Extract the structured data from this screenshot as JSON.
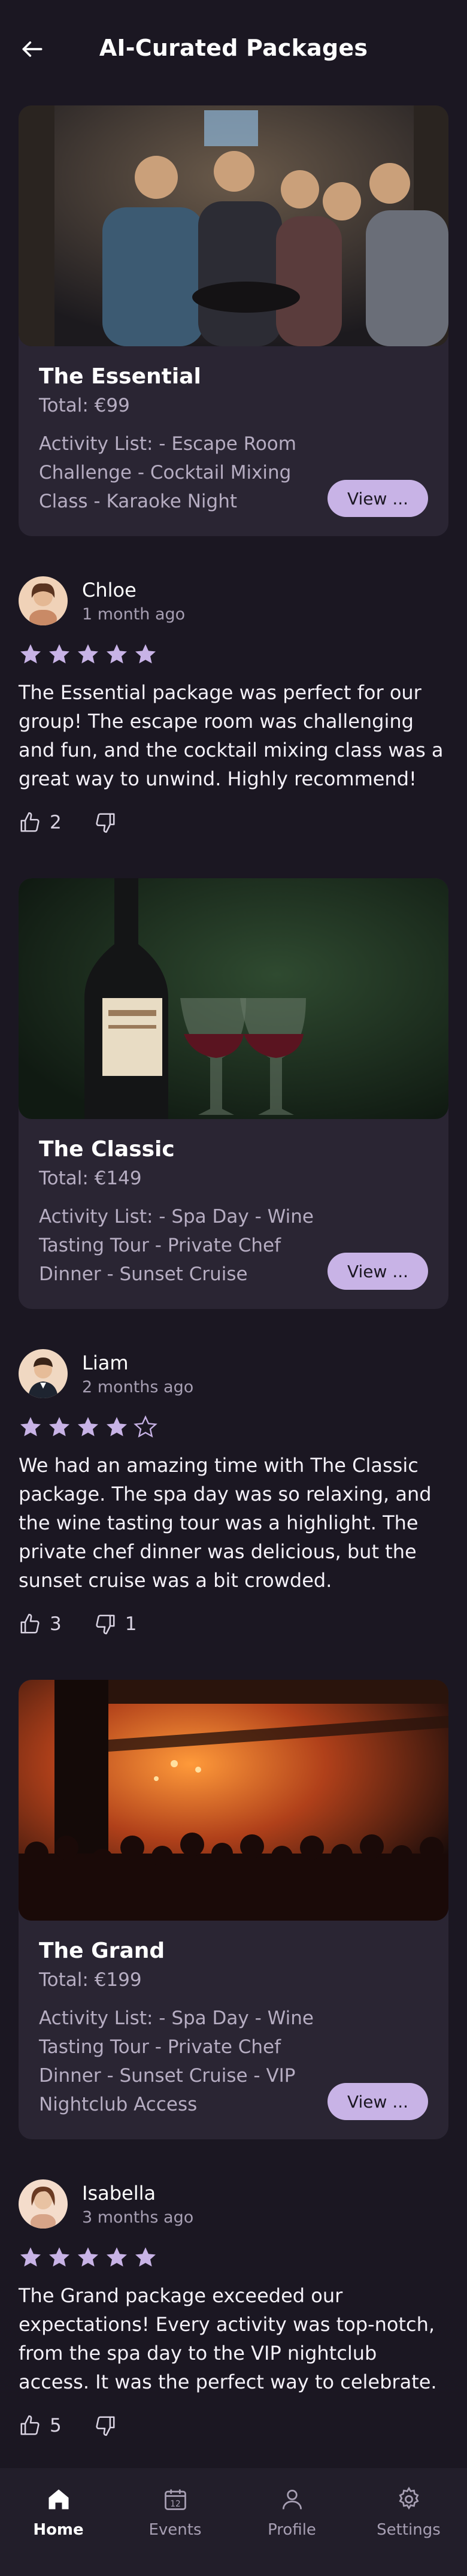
{
  "header": {
    "title": "AI-Curated Packages",
    "back_icon": "arrow-left-icon"
  },
  "packages": [
    {
      "name": "The Essential",
      "total": "Total: €99",
      "activities": "Activity List: - Escape Room Challenge - Cocktail Mixing Class - Karaoke Night",
      "button": "View ...",
      "image": "group-of-friends-in-bar-photo"
    },
    {
      "name": "The Classic",
      "total": "Total: €149",
      "activities": "Activity List: - Spa Day - Wine Tasting Tour - Private Chef Dinner - Sunset Cruise",
      "button": "View ...",
      "image": "wine-bottle-and-glasses-photo"
    },
    {
      "name": "The Grand",
      "total": "Total: €199",
      "activities": "Activity List: - Spa Day - Wine Tasting Tour - Private Chef Dinner - Sunset Cruise - VIP Nightclub Access",
      "button": "View ...",
      "image": "nightclub-crowd-photo"
    }
  ],
  "reviews": [
    {
      "name": "Chloe",
      "time": "1 month ago",
      "rating": 5,
      "text": "The Essential package was perfect for our group! The escape room was challenging and fun, and the cocktail mixing class was a great way to unwind. Highly recommend!",
      "likes": "2",
      "dislikes": ""
    },
    {
      "name": "Liam",
      "time": "2 months ago",
      "rating": 4,
      "text": "We had an amazing time with The Classic package. The spa day was so relaxing, and the wine tasting tour was a highlight. The private chef dinner was delicious, but the sunset cruise was a bit crowded.",
      "likes": "3",
      "dislikes": "1"
    },
    {
      "name": "Isabella",
      "time": "3 months ago",
      "rating": 5,
      "text": "The Grand package exceeded our expectations! Every activity was top-notch, from the spa day to the VIP nightclub access. It was the perfect way to celebrate.",
      "likes": "5",
      "dislikes": ""
    }
  ],
  "nav": {
    "items": [
      {
        "label": "Home",
        "icon": "home-icon",
        "active": true
      },
      {
        "label": "Events",
        "icon": "calendar-icon",
        "calendar_day": "12"
      },
      {
        "label": "Profile",
        "icon": "user-icon"
      },
      {
        "label": "Settings",
        "icon": "gear-icon"
      }
    ]
  },
  "colors": {
    "background": "#1b1722",
    "card": "#2a2533",
    "accent": "#c8b3e6",
    "star": "#c8b3e6"
  }
}
